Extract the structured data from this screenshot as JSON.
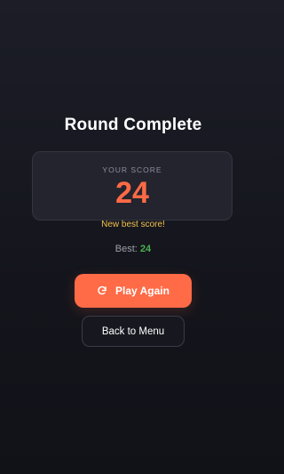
{
  "round": {
    "title": "Round Complete"
  },
  "score": {
    "label": "YOUR SCORE",
    "value": "24",
    "new_best_message": "New best score!"
  },
  "best": {
    "prefix": "Best:",
    "value": "24"
  },
  "actions": {
    "play_again_label": "Play Again",
    "play_again_icon": "restart-icon",
    "back_label": "Back to Menu"
  },
  "colors": {
    "accent": "#ff6b47",
    "score": "#ff6a45",
    "highlight": "#f2c14e",
    "best": "#4caf50",
    "background": "#17181f"
  }
}
